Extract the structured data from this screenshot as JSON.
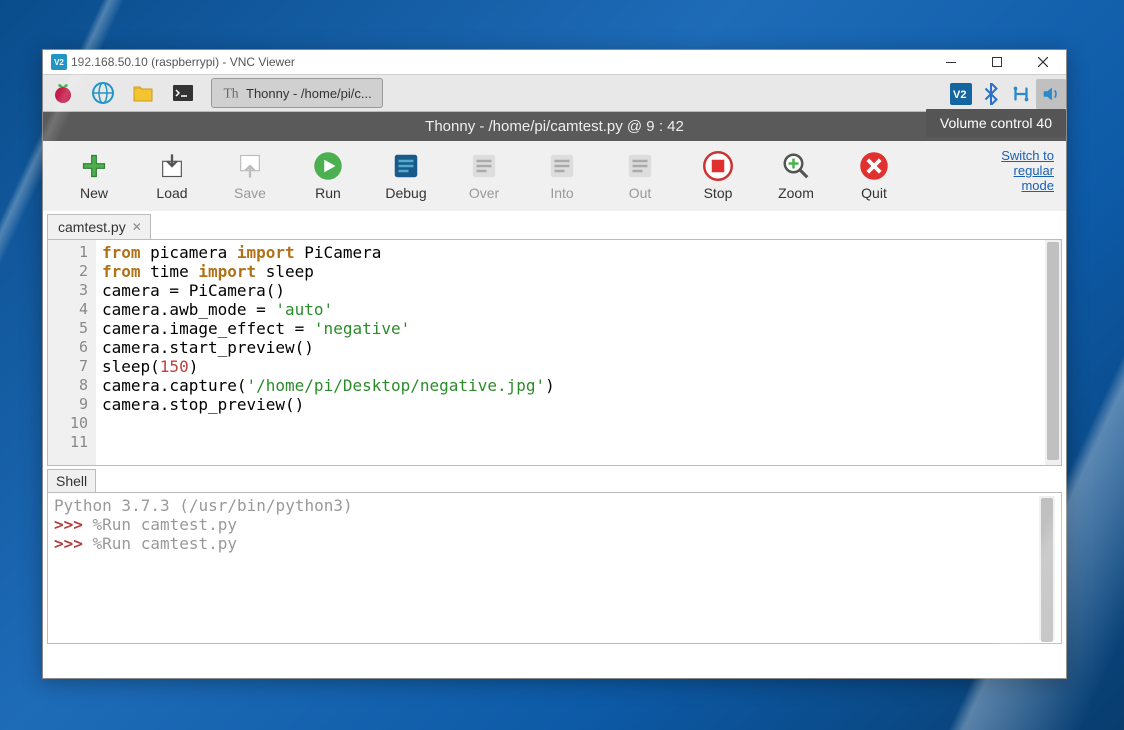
{
  "vnc": {
    "title": "192.168.50.10 (raspberrypi) - VNC Viewer"
  },
  "taskbar": {
    "thonny_item": "Thonny  -  /home/pi/c..."
  },
  "tooltip": {
    "volume": "Volume control 40"
  },
  "thonny": {
    "title": "Thonny  -  /home/pi/camtest.py  @  9 : 42",
    "switch": "Switch to\nregular\nmode"
  },
  "toolbar": {
    "new": "New",
    "load": "Load",
    "save": "Save",
    "run": "Run",
    "debug": "Debug",
    "over": "Over",
    "into": "Into",
    "out": "Out",
    "stop": "Stop",
    "zoom": "Zoom",
    "quit": "Quit"
  },
  "file": {
    "tab": "camtest.py"
  },
  "code": {
    "lines": [
      {
        "n": "1",
        "segs": [
          [
            "kw",
            "from"
          ],
          [
            "",
            " picamera "
          ],
          [
            "kw",
            "import"
          ],
          [
            "",
            " PiCamera"
          ]
        ]
      },
      {
        "n": "2",
        "segs": [
          [
            "kw",
            "from"
          ],
          [
            "",
            " time "
          ],
          [
            "kw",
            "import"
          ],
          [
            "",
            " sleep"
          ]
        ]
      },
      {
        "n": "3",
        "segs": [
          [
            "",
            ""
          ]
        ]
      },
      {
        "n": "4",
        "segs": [
          [
            "",
            "camera = PiCamera()"
          ]
        ]
      },
      {
        "n": "5",
        "segs": [
          [
            "",
            "camera.awb_mode = "
          ],
          [
            "str",
            "'auto'"
          ]
        ]
      },
      {
        "n": "6",
        "segs": [
          [
            "",
            "camera.image_effect = "
          ],
          [
            "str",
            "'negative'"
          ]
        ]
      },
      {
        "n": "7",
        "segs": [
          [
            "",
            "camera.start_preview()"
          ]
        ]
      },
      {
        "n": "8",
        "segs": [
          [
            "",
            "sleep("
          ],
          [
            "num",
            "150"
          ],
          [
            "",
            ")"
          ]
        ]
      },
      {
        "n": "9",
        "segs": [
          [
            "",
            "camera.capture("
          ],
          [
            "str",
            "'/home/pi/Desktop/negative.jpg'"
          ],
          [
            "",
            ")"
          ]
        ]
      },
      {
        "n": "10",
        "segs": [
          [
            "",
            "camera.stop_preview()"
          ]
        ]
      },
      {
        "n": "11",
        "segs": [
          [
            "",
            ""
          ]
        ]
      }
    ]
  },
  "shell": {
    "tab": "Shell",
    "header": "Python 3.7.3 (/usr/bin/python3)",
    "lines": [
      "%Run camtest.py",
      "%Run camtest.py"
    ],
    "prompt": ">>> "
  }
}
